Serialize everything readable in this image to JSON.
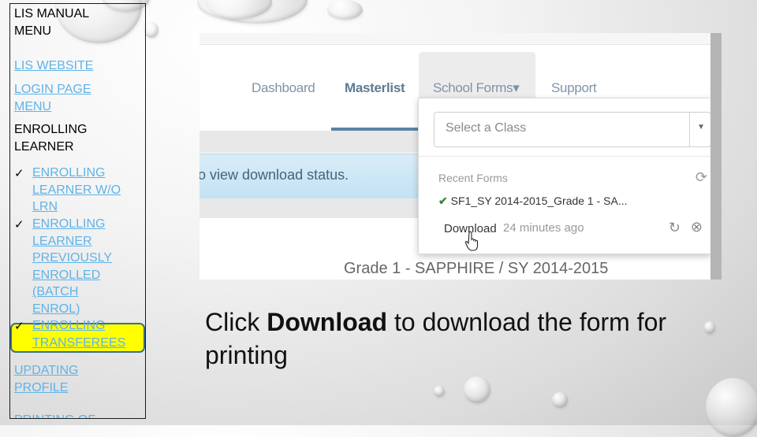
{
  "sidebar": {
    "title": [
      "LIS MANUAL",
      "MENU"
    ],
    "links": {
      "lis_website": "LIS WEBSITE",
      "login_page_menu": [
        "LOGIN PAGE",
        "MENU"
      ]
    },
    "section_heading": [
      "ENROLLING",
      "LEARNER"
    ],
    "checklist": [
      {
        "mark": "✓",
        "lines": [
          "ENROLLING",
          "LEARNER W/O",
          "LRN"
        ]
      },
      {
        "mark": "✓",
        "lines": [
          "ENROLLING",
          "LEARNER",
          "PREVIOUSLY",
          "ENROLLED",
          "(BATCH",
          "ENROL)"
        ]
      },
      {
        "mark": "✓",
        "lines": [
          "ENROLLING",
          "TRANSFEREES"
        ],
        "highlighted": true
      }
    ],
    "updating_profile": [
      "UPDATING",
      "PROFILE"
    ],
    "printing_of": "PRINTING OF"
  },
  "screenshot": {
    "nav": {
      "items": [
        "Dashboard",
        "Masterlist",
        "School Forms▾",
        "Support"
      ],
      "active": "Masterlist"
    },
    "info_text": "o view download status.",
    "class_title": "Grade 1 - SAPPHIRE / SY 2014-2015",
    "dropdown": {
      "select_placeholder": "Select a Class",
      "select_arrow": "▼",
      "recent_label": "Recent Forms",
      "refresh_icon": "⟳",
      "form_check": "✔",
      "form_name": "SF1_SY 2014-2015_Grade 1 - SA...",
      "download_label": "Download",
      "time_ago": "24 minutes ago",
      "retry_icon": "↻",
      "cancel_icon": "⊗"
    }
  },
  "caption": {
    "before": "Click ",
    "bold": "Download",
    "after": " to download the form for printing"
  },
  "colors": {
    "link": "#5fb3e8",
    "highlight": "#ffff00",
    "nav_active": "#5d7b93",
    "nav_underline": "#5b84a3"
  }
}
